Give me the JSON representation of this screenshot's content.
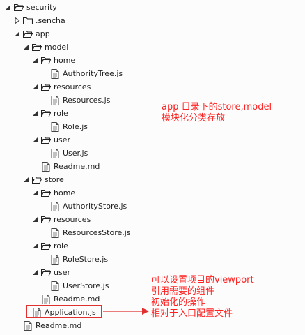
{
  "tree": [
    {
      "label": "security",
      "kind": "folder",
      "depth": 0,
      "expanded": true
    },
    {
      "label": ".sencha",
      "kind": "folder",
      "depth": 1,
      "expanded": false
    },
    {
      "label": "app",
      "kind": "folder",
      "depth": 1,
      "expanded": true
    },
    {
      "label": "model",
      "kind": "folder",
      "depth": 2,
      "expanded": true
    },
    {
      "label": "home",
      "kind": "folder",
      "depth": 3,
      "expanded": true
    },
    {
      "label": "AuthorityTree.js",
      "kind": "file",
      "depth": 4
    },
    {
      "label": "resources",
      "kind": "folder",
      "depth": 3,
      "expanded": true
    },
    {
      "label": "Resources.js",
      "kind": "file",
      "depth": 4
    },
    {
      "label": "role",
      "kind": "folder",
      "depth": 3,
      "expanded": true
    },
    {
      "label": "Role.js",
      "kind": "file",
      "depth": 4
    },
    {
      "label": "user",
      "kind": "folder",
      "depth": 3,
      "expanded": true
    },
    {
      "label": "User.js",
      "kind": "file",
      "depth": 4
    },
    {
      "label": "Readme.md",
      "kind": "file",
      "depth": 3
    },
    {
      "label": "store",
      "kind": "folder",
      "depth": 2,
      "expanded": true
    },
    {
      "label": "home",
      "kind": "folder",
      "depth": 3,
      "expanded": true
    },
    {
      "label": "AuthorityStore.js",
      "kind": "file",
      "depth": 4
    },
    {
      "label": "resources",
      "kind": "folder",
      "depth": 3,
      "expanded": true
    },
    {
      "label": "ResourcesStore.js",
      "kind": "file",
      "depth": 4
    },
    {
      "label": "role",
      "kind": "folder",
      "depth": 3,
      "expanded": true
    },
    {
      "label": "RoleStore.js",
      "kind": "file",
      "depth": 4
    },
    {
      "label": "user",
      "kind": "folder",
      "depth": 3,
      "expanded": true
    },
    {
      "label": "UserStore.js",
      "kind": "file",
      "depth": 4
    },
    {
      "label": "Readme.md",
      "kind": "file",
      "depth": 3
    },
    {
      "label": "Application.js",
      "kind": "file",
      "depth": 2,
      "highlighted": true
    },
    {
      "label": "Readme.md",
      "kind": "file",
      "depth": 1
    }
  ],
  "annotations": {
    "store_note": [
      "app 目录下的store,model",
      "模块化分类存放"
    ],
    "app_note": [
      "可以设置项目的viewport",
      "引用需要的组件",
      "初始化的操作",
      "相对于入口配置文件"
    ]
  },
  "colors": {
    "annotation": "#ff2020",
    "highlight_border": "#e03030",
    "text": "#222222",
    "background": "#fcfcfc"
  },
  "icons": {
    "folder_open": "folder-open-icon",
    "folder_closed": "folder-icon",
    "file": "file-icon",
    "expanded": "chevron-expanded-icon",
    "collapsed": "chevron-collapsed-icon"
  }
}
